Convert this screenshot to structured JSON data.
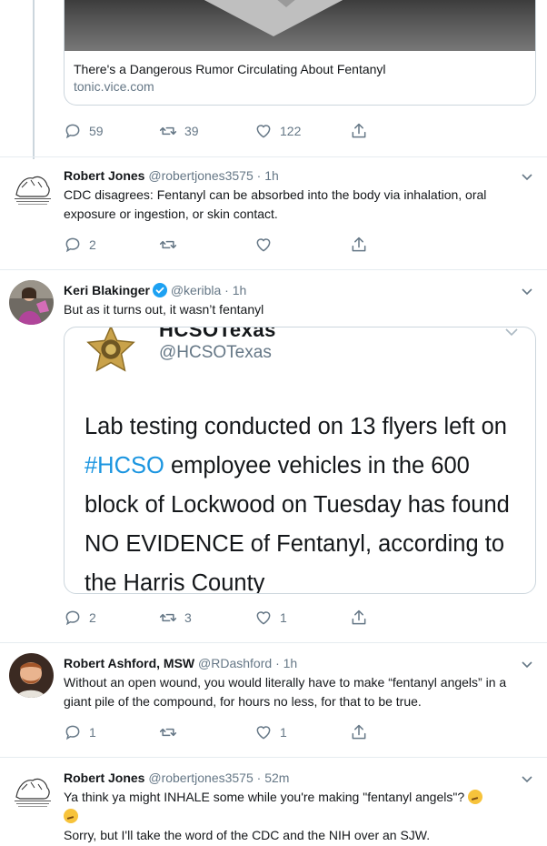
{
  "top_tweet": {
    "card_title": "There's a Dangerous Rumor Circulating About Fentanyl",
    "card_domain": "tonic.vice.com",
    "replies": "59",
    "retweets": "39",
    "likes": "122"
  },
  "tweets": [
    {
      "name": "Robert Jones",
      "handle": "@robertjones3575",
      "time": "· 1h",
      "text": "CDC disagrees: Fentanyl can be absorbed into the body via inhalation, oral exposure or ingestion, or skin contact.",
      "replies": "2",
      "retweets": "",
      "likes": ""
    },
    {
      "name": "Keri Blakinger",
      "handle": "@keribla",
      "time": "· 1h",
      "text": "But as it turns out, it wasn’t fentanyl",
      "replies": "2",
      "retweets": "3",
      "likes": "1",
      "embed": {
        "name": "HCSOTexas",
        "handle": "@HCSOTexas",
        "text_before": "Lab testing conducted on 13 flyers left on ",
        "hashtag": "#HCSO",
        "text_after": " employee vehicles in the 600 block of Lockwood on Tuesday has found NO EVIDENCE of Fentanyl, according to the Harris County"
      }
    },
    {
      "name": "Robert Ashford, MSW",
      "handle": "@RDashford",
      "time": "· 1h",
      "text": "Without an open wound, you would literally have to make “fentanyl angels” in a giant pile of the compound, for hours no less, for that to be true.",
      "replies": "1",
      "retweets": "",
      "likes": "1"
    },
    {
      "name": "Robert Jones",
      "handle": "@robertjones3575",
      "time": "· 52m",
      "text_line1": "Ya think ya might INHALE some while you're making \"fentanyl angels\"?",
      "text_line2": "Sorry, but I'll take the word of the CDC and the NIH over an SJW."
    }
  ],
  "colors": {
    "accent": "#1da1f2",
    "muted": "#657786",
    "border": "#e6ecf0"
  },
  "icons": [
    "reply-icon",
    "retweet-icon",
    "like-icon",
    "share-icon",
    "chevron-down-icon",
    "verified-icon"
  ]
}
